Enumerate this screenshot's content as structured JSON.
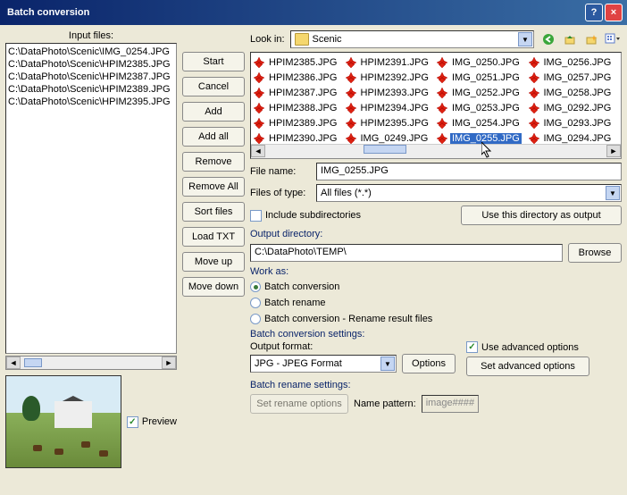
{
  "title": "Batch conversion",
  "input_files_label": "Input files:",
  "input_files": [
    "C:\\DataPhoto\\Scenic\\IMG_0254.JPG",
    "C:\\DataPhoto\\Scenic\\HPIM2385.JPG",
    "C:\\DataPhoto\\Scenic\\HPIM2387.JPG",
    "C:\\DataPhoto\\Scenic\\HPIM2389.JPG",
    "C:\\DataPhoto\\Scenic\\HPIM2395.JPG"
  ],
  "buttons": {
    "start": "Start",
    "cancel": "Cancel",
    "add": "Add",
    "add_all": "Add all",
    "remove": "Remove",
    "remove_all": "Remove All",
    "sort_files": "Sort files",
    "load_txt": "Load TXT",
    "move_up": "Move up",
    "move_down": "Move down",
    "use_dir": "Use this directory as output",
    "browse": "Browse",
    "options": "Options",
    "set_adv": "Set advanced options",
    "set_rename": "Set rename options"
  },
  "preview_label": "Preview",
  "lookin_label": "Look in:",
  "lookin_value": "Scenic",
  "files": [
    [
      "HPIM2385.JPG",
      "HPIM2391.JPG",
      "IMG_0250.JPG",
      "IMG_0256.JPG"
    ],
    [
      "HPIM2386.JPG",
      "HPIM2392.JPG",
      "IMG_0251.JPG",
      "IMG_0257.JPG"
    ],
    [
      "HPIM2387.JPG",
      "HPIM2393.JPG",
      "IMG_0252.JPG",
      "IMG_0258.JPG"
    ],
    [
      "HPIM2388.JPG",
      "HPIM2394.JPG",
      "IMG_0253.JPG",
      "IMG_0292.JPG"
    ],
    [
      "HPIM2389.JPG",
      "HPIM2395.JPG",
      "IMG_0254.JPG",
      "IMG_0293.JPG"
    ],
    [
      "HPIM2390.JPG",
      "IMG_0249.JPG",
      "IMG_0255.JPG",
      "IMG_0294.JPG"
    ]
  ],
  "selected_file": "IMG_0255.JPG",
  "filename_label": "File name:",
  "filename_value": "IMG_0255.JPG",
  "filetype_label": "Files of type:",
  "filetype_value": "All files (*.*)",
  "include_sub": "Include subdirectories",
  "outdir_label": "Output directory:",
  "outdir_value": "C:\\DataPhoto\\TEMP\\",
  "workas_label": "Work as:",
  "workas_options": [
    "Batch conversion",
    "Batch rename",
    "Batch conversion - Rename result files"
  ],
  "workas_selected": 0,
  "bcs_label": "Batch conversion settings:",
  "outfmt_label": "Output format:",
  "outfmt_value": "JPG - JPEG Format",
  "use_adv": "Use advanced options",
  "brs_label": "Batch rename settings:",
  "name_pattern_label": "Name pattern:",
  "name_pattern_value": "image####"
}
